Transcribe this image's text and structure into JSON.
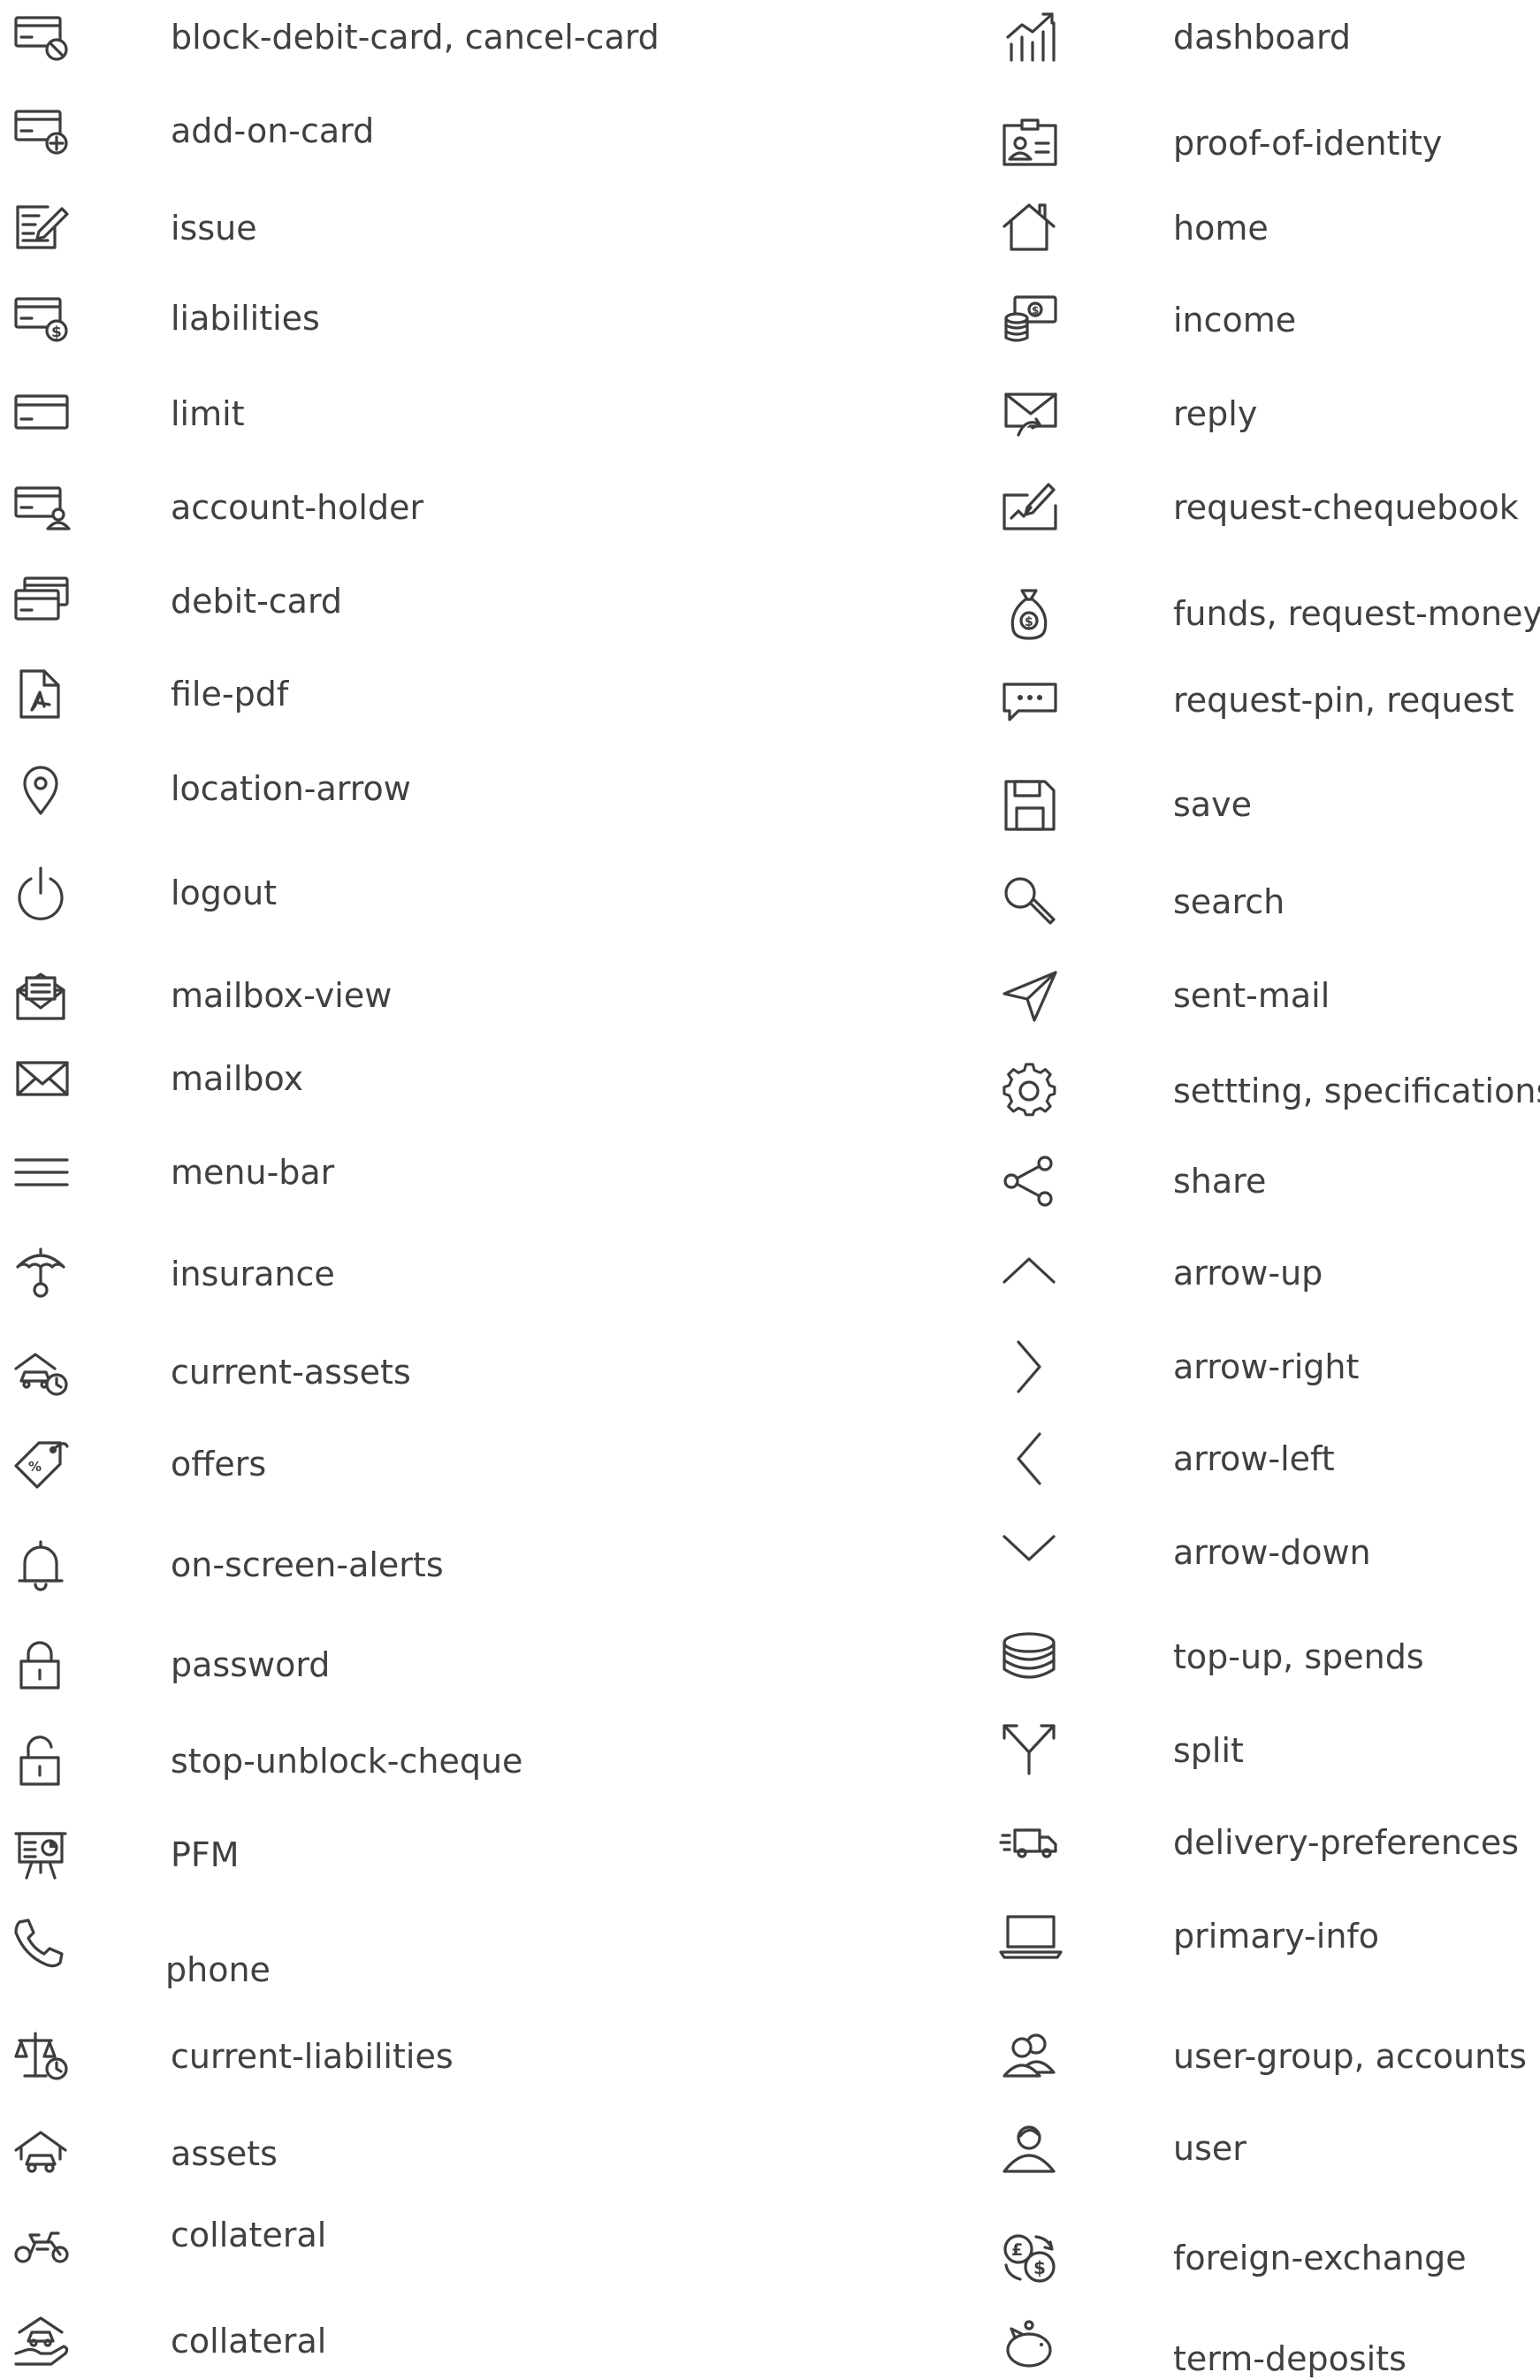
{
  "left_items": [
    {
      "icon": "block-debit-card-icon",
      "label": "block-debit-card, cancel-card"
    },
    {
      "icon": "add-on-card-icon",
      "label": "add-on-card"
    },
    {
      "icon": "issue-icon",
      "label": "issue"
    },
    {
      "icon": "liabilities-icon",
      "label": "liabilities"
    },
    {
      "icon": "limit-icon",
      "label": "limit"
    },
    {
      "icon": "account-holder-icon",
      "label": "account-holder"
    },
    {
      "icon": "debit-card-icon",
      "label": "debit-card"
    },
    {
      "icon": "file-pdf-icon",
      "label": "file-pdf"
    },
    {
      "icon": "location-arrow-icon",
      "label": "location-arrow"
    },
    {
      "icon": "logout-icon",
      "label": "logout"
    },
    {
      "icon": "mailbox-view-icon",
      "label": "mailbox-view"
    },
    {
      "icon": "mailbox-icon",
      "label": "mailbox"
    },
    {
      "icon": "menu-bar-icon",
      "label": "menu-bar"
    },
    {
      "icon": "insurance-icon",
      "label": "insurance"
    },
    {
      "icon": "current-assets-icon",
      "label": "current-assets"
    },
    {
      "icon": "offers-icon",
      "label": "offers"
    },
    {
      "icon": "on-screen-alerts-icon",
      "label": "on-screen-alerts"
    },
    {
      "icon": "password-icon",
      "label": "password"
    },
    {
      "icon": "stop-unblock-cheque-icon",
      "label": "stop-unblock-cheque"
    },
    {
      "icon": "pfm-icon",
      "label": "PFM"
    },
    {
      "icon": "phone-icon",
      "label": "phone"
    },
    {
      "icon": "current-liabilities-icon",
      "label": "current-liabilities"
    },
    {
      "icon": "assets-icon",
      "label": "assets"
    },
    {
      "icon": "collateral-bike-icon",
      "label": "collateral"
    },
    {
      "icon": "collateral-car-hand-icon",
      "label": "collateral"
    }
  ],
  "right_items": [
    {
      "icon": "dashboard-icon",
      "label": "dashboard"
    },
    {
      "icon": "proof-of-identity-icon",
      "label": "proof-of-identity"
    },
    {
      "icon": "home-icon",
      "label": "home"
    },
    {
      "icon": "income-icon",
      "label": "income"
    },
    {
      "icon": "reply-icon",
      "label": "reply"
    },
    {
      "icon": "request-chequebook-icon",
      "label": "request-chequebook"
    },
    {
      "icon": "money-bag-icon",
      "label": "funds, request-money"
    },
    {
      "icon": "chat-bubble-icon",
      "label": "request-pin, request"
    },
    {
      "icon": "save-icon",
      "label": "save"
    },
    {
      "icon": "search-icon",
      "label": "search"
    },
    {
      "icon": "sent-mail-icon",
      "label": "sent-mail"
    },
    {
      "icon": "gear-icon",
      "label": "settting, specifications"
    },
    {
      "icon": "share-icon",
      "label": "share"
    },
    {
      "icon": "arrow-up-icon",
      "label": "arrow-up"
    },
    {
      "icon": "arrow-right-icon",
      "label": "arrow-right"
    },
    {
      "icon": "arrow-left-icon",
      "label": "arrow-left"
    },
    {
      "icon": "arrow-down-icon",
      "label": "arrow-down"
    },
    {
      "icon": "coin-stack-icon",
      "label": "top-up, spends"
    },
    {
      "icon": "split-icon",
      "label": "split"
    },
    {
      "icon": "delivery-truck-icon",
      "label": "delivery-preferences"
    },
    {
      "icon": "laptop-icon",
      "label": "primary-info"
    },
    {
      "icon": "user-group-icon",
      "label": "user-group, accounts"
    },
    {
      "icon": "user-icon",
      "label": "user"
    },
    {
      "icon": "foreign-exchange-icon",
      "label": "foreign-exchange"
    },
    {
      "icon": "piggy-bank-icon",
      "label": "term-deposits"
    }
  ],
  "icon_color": "#3d3d3d",
  "text_color": "#404040"
}
